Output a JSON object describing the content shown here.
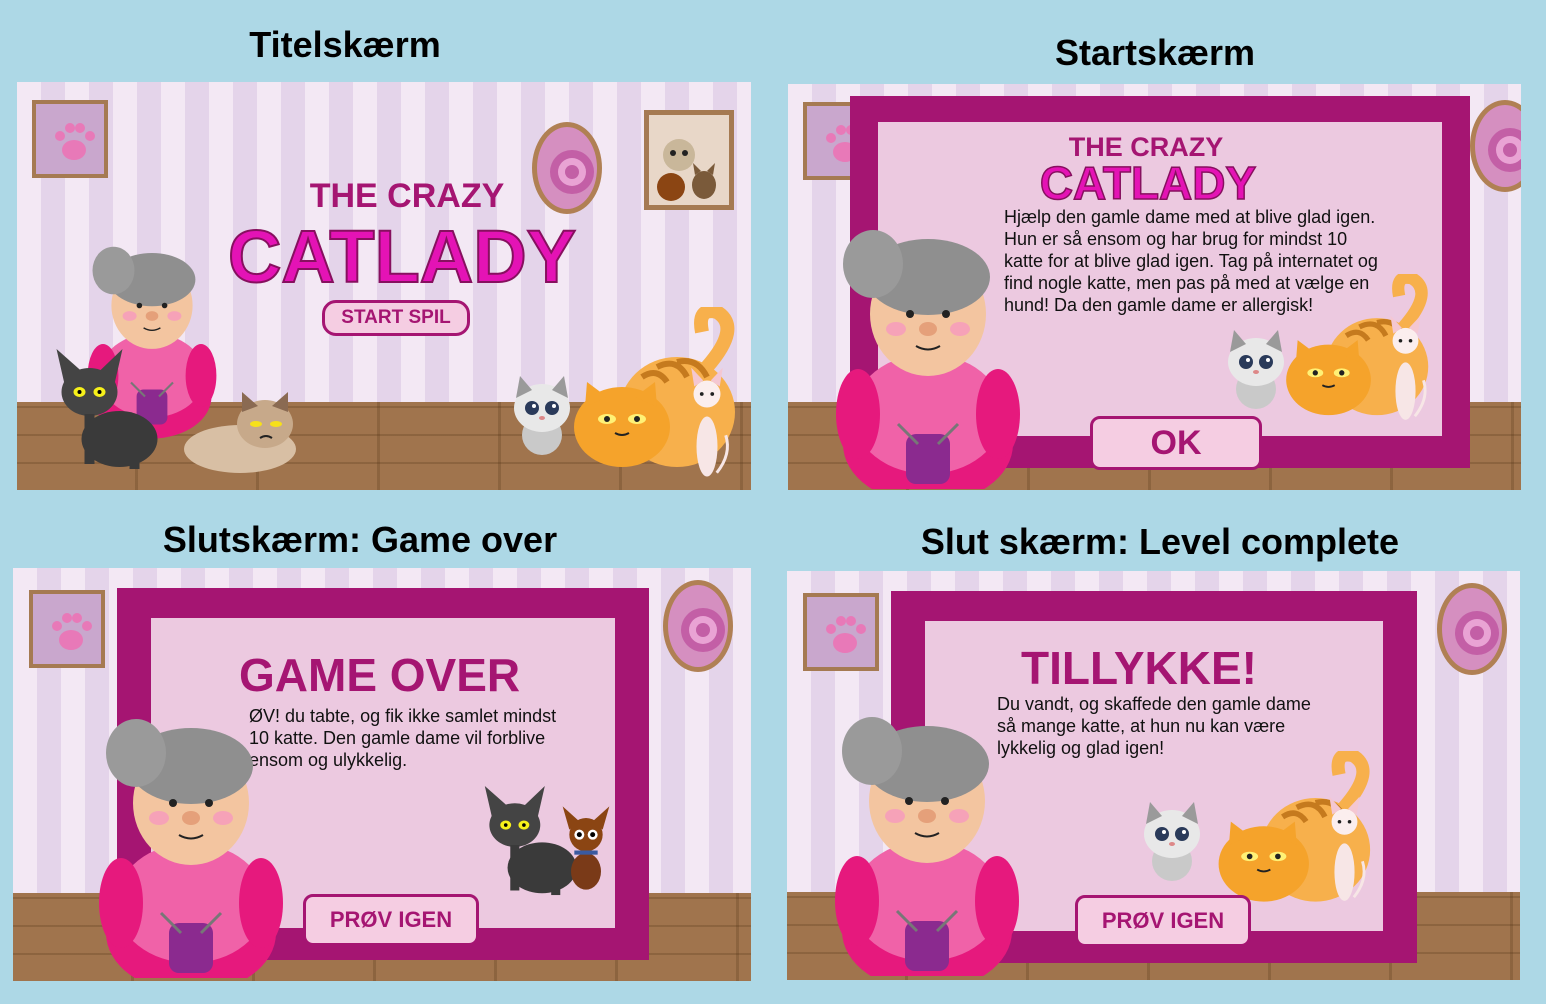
{
  "headings": {
    "title_screen": "Titelskærm",
    "start_screen": "Startskærm",
    "game_over_screen": "Slutskærm: Game over",
    "level_complete_screen": "Slut skærm: Level complete"
  },
  "title_screen": {
    "logo_line1": "THE CRAZY",
    "logo_line2": "CATLADY",
    "start_button": "START SPIL"
  },
  "start_screen": {
    "logo_line1": "THE CRAZY",
    "logo_line2": "CATLADY",
    "intro_text": "Hjælp den gamle dame med at blive glad igen. Hun er så ensom og har brug for mindst 10 katte for at blive glad igen. Tag på internatet og find nogle katte, men pas på med at vælge en hund! Da den gamle dame er allergisk!",
    "ok_button": "OK"
  },
  "game_over_screen": {
    "title": "GAME OVER",
    "text": "ØV! du tabte, og fik ikke samlet mindst 10 katte. Den gamle dame vil forblive ensom og ulykkelig.",
    "retry_button": "PRØV IGEN"
  },
  "level_complete_screen": {
    "title": "TILLYKKE!",
    "text": "Du vandt, og skaffede den gamle dame så mange katte, at hun nu kan være lykkelig og glad igen!",
    "retry_button": "PRØV IGEN"
  },
  "colors": {
    "accent": "#a51572",
    "logo_pink": "#e413b5",
    "background": "#add8e6",
    "floor": "#a0744d"
  }
}
